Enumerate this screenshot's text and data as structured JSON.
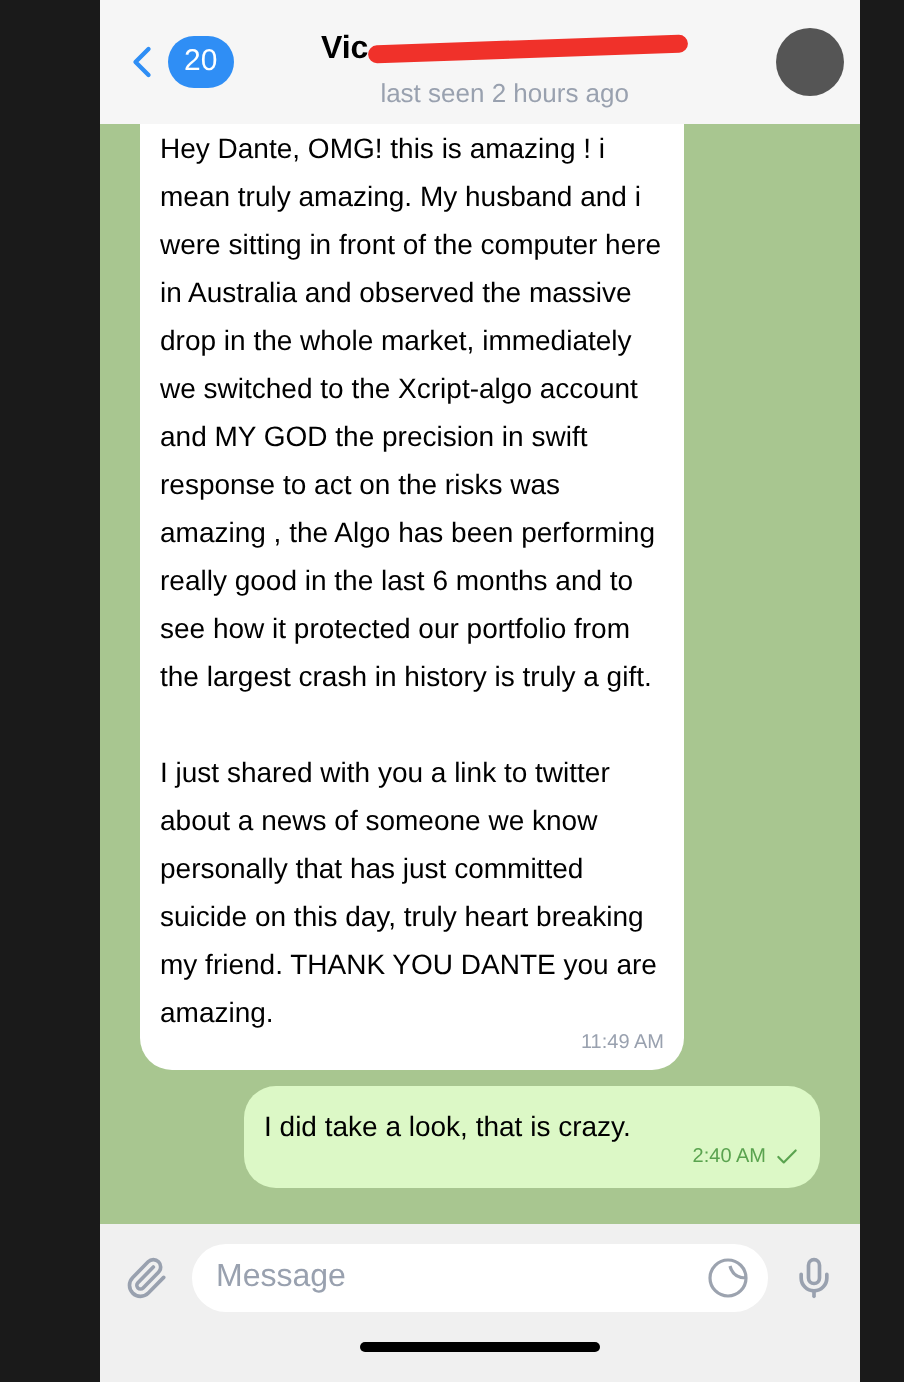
{
  "header": {
    "back_count": "20",
    "title": "Vic",
    "subtitle": "last seen 2 hours ago"
  },
  "messages": [
    {
      "kind": "incoming",
      "paragraphs": [
        "Hey Dante, OMG! this is amazing ! i mean truly amazing. My husband and i were sitting in front of the computer here in Australia and observed the massive drop in the whole market, immediately we switched to the Xcript-algo account and MY GOD the precision in swift response to act on the risks was amazing , the Algo has been performing really good in the last 6 months and to see how it protected our portfolio from the largest crash in history is truly a gift.",
        "I just shared with you a link to twitter about a news of someone we know personally that has just committed suicide on this day, truly heart breaking my friend. THANK YOU DANTE you are amazing."
      ],
      "time": "11:49 AM"
    },
    {
      "kind": "outgoing",
      "paragraphs": [
        "I did take a look, that is crazy."
      ],
      "time": "2:40 AM",
      "read": true
    }
  ],
  "composer": {
    "placeholder": "Message"
  }
}
